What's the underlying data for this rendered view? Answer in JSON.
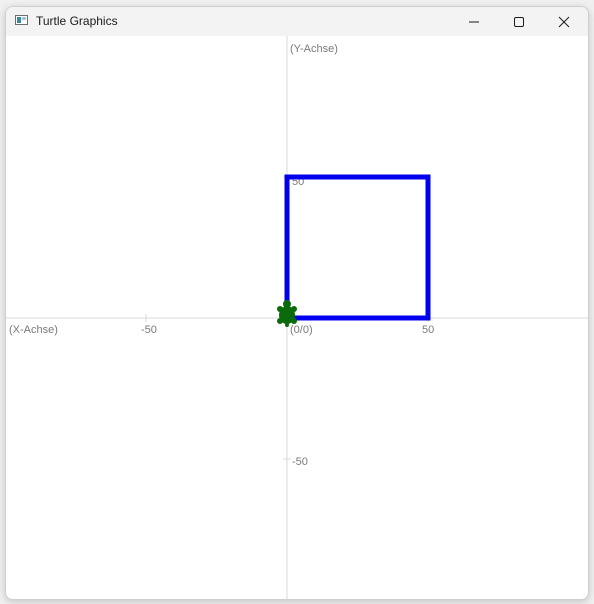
{
  "window": {
    "title": "Turtle Graphics",
    "icon": "app-window-icon",
    "controls": {
      "minimize_icon": "minimize-icon",
      "maximize_icon": "maximize-icon",
      "close_icon": "close-icon"
    }
  },
  "canvas": {
    "y_axis_label": "(Y-Achse)",
    "x_axis_label": "(X-Achse)",
    "origin_label": "(0/0)",
    "tick_labels": {
      "x_neg_50": "-50",
      "x_pos_50": "50",
      "y_pos_50": "50",
      "y_neg_50": "-50"
    },
    "colors": {
      "axis": "#d9d9d9",
      "path": "#0000ee",
      "turtle": "#0b6b0b",
      "label": "#7a7a7a"
    },
    "drawn_path": {
      "description_units": "turtle coordinates",
      "points": [
        [
          0,
          0
        ],
        [
          0,
          50
        ],
        [
          50,
          50
        ],
        [
          50,
          0
        ],
        [
          0,
          0
        ]
      ]
    },
    "turtle": {
      "x": 0,
      "y": 0,
      "heading": "up",
      "icon": "turtle-icon"
    }
  }
}
